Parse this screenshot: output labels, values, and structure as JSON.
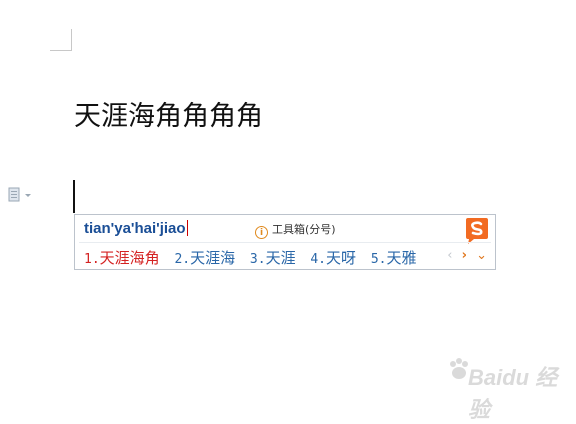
{
  "document": {
    "text": "天涯海角角角角"
  },
  "ime": {
    "pinyin": "tian'ya'hai'jiao",
    "toolbox_label": "工具箱(分号)",
    "candidates": [
      {
        "num": "1.",
        "text": "天涯海角"
      },
      {
        "num": "2.",
        "text": "天涯海"
      },
      {
        "num": "3.",
        "text": "天涯"
      },
      {
        "num": "4.",
        "text": "天呀"
      },
      {
        "num": "5.",
        "text": "天雅"
      }
    ],
    "nav": {
      "prev": "‹",
      "next": "›",
      "more": "⌄"
    },
    "logo_icon": "sogou-logo-icon",
    "info_icon": "info-icon"
  },
  "watermark": {
    "text": "Baidu 经验"
  },
  "colors": {
    "pinyin": "#1a4e96",
    "selected_candidate": "#d42222",
    "candidate": "#2a67a8",
    "accent": "#e07820"
  }
}
